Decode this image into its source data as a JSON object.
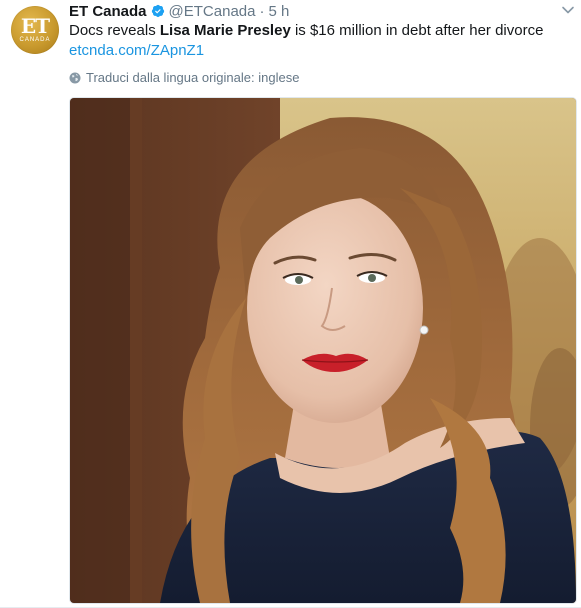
{
  "account": {
    "name": "ET Canada",
    "handle": "@ETCanada",
    "separator": "·",
    "time": "5 h",
    "avatar_logo_main": "ET",
    "avatar_logo_sub": "CANADA",
    "verified_icon": "verified-badge",
    "menu_icon": "chevron-down"
  },
  "tweet": {
    "text_pre": "Docs reveals ",
    "text_bold": "Lisa Marie Presley",
    "text_post": " is $16 million in debt after her divorce",
    "link": "etcnda.com/ZApnZ1",
    "translate": "Traduci dalla lingua originale: inglese"
  },
  "colors": {
    "link": "#1b95e0",
    "muted": "#657786",
    "text": "#14171a",
    "verified": "#1da1f2",
    "avatar_gold": "#c99a2e"
  }
}
